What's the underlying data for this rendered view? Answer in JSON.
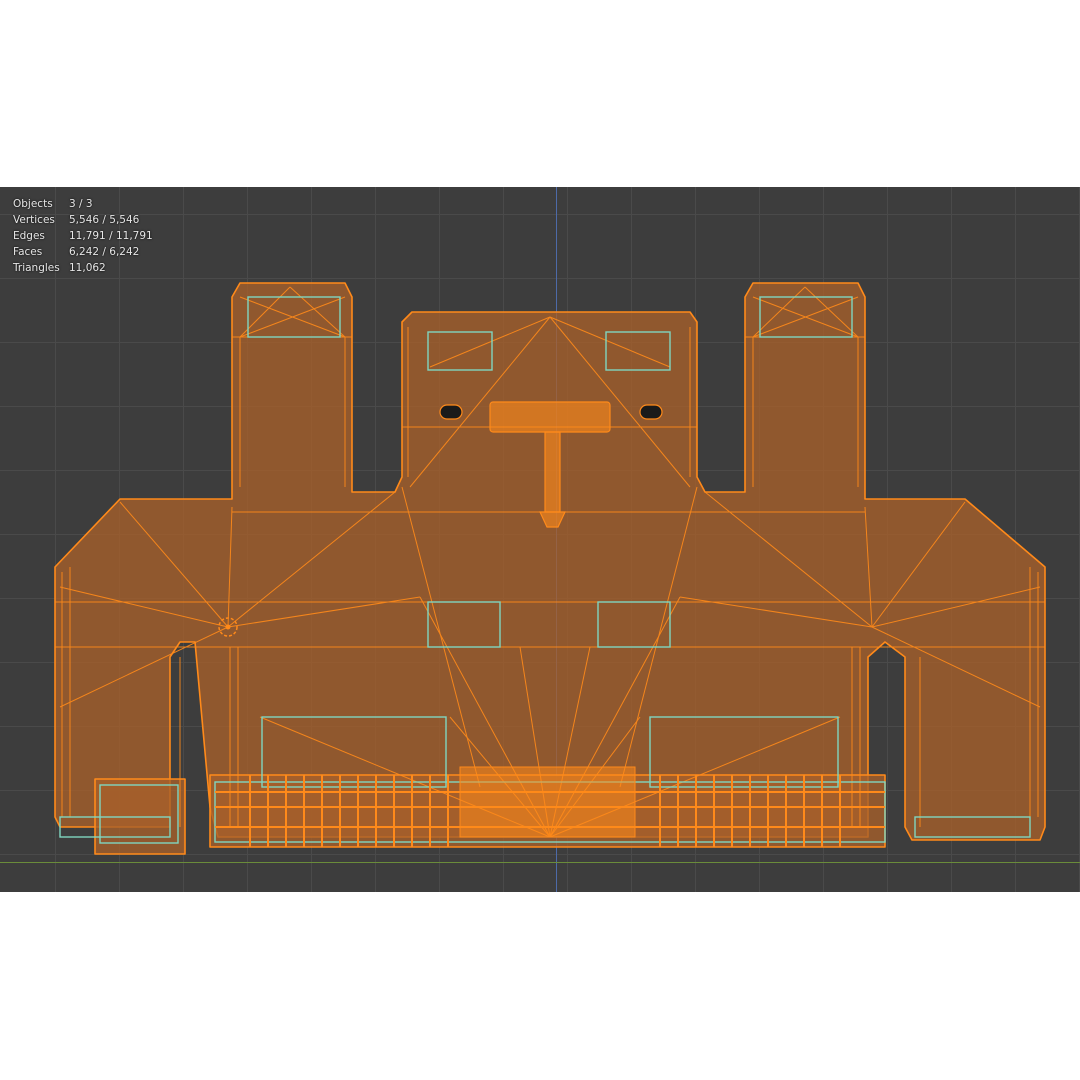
{
  "stats": {
    "objects": {
      "label": "Objects",
      "value": "3 / 3"
    },
    "vertices": {
      "label": "Vertices",
      "value": "5,546 / 5,546"
    },
    "edges": {
      "label": "Edges",
      "value": "11,791 / 11,791"
    },
    "faces": {
      "label": "Faces",
      "value": "6,242 / 6,242"
    },
    "triangles": {
      "label": "Triangles",
      "value": "11,062"
    }
  },
  "colors": {
    "viewport_bg": "#3d3d3d",
    "grid": "#4a4a4a",
    "wire_selected": "#ff8a1a",
    "face_fill": "#a8602a",
    "edge_highlight": "#7fd6c0",
    "axis_y": "#4d6aa8",
    "axis_x": "#6a8c3a"
  },
  "icons": {
    "origin": "object-origin-icon"
  }
}
